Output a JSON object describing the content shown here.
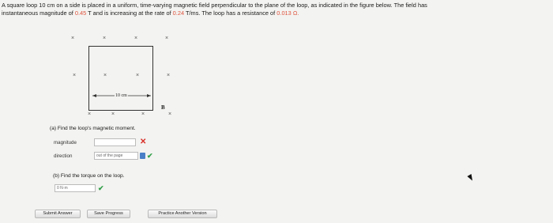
{
  "problem": {
    "pre1": "A square loop 10 cm on a side is placed in a uniform, time-varying magnetic field perpendicular to the plane of the loop, as indicated in the figure below. The field has",
    "pre2": "instantaneous magnitude of ",
    "value_b": "0.45",
    "mid1": " T and is increasing at the rate of ",
    "value_rate": "0.24",
    "mid2": " T/ms. The loop has a resistance of ",
    "value_r": "0.013",
    "unit_r": " Ω."
  },
  "figure": {
    "cross_glyph": "×",
    "dimension_label": "10 cm",
    "field_label": "B"
  },
  "part_a": {
    "title": "(a) Find the loop's magnetic moment.",
    "magnitude_label": "magnitude",
    "magnitude_value": "",
    "direction_label": "direction",
    "direction_value": "out of the page"
  },
  "part_b": {
    "title": "(b) Find the torque on the loop.",
    "torque_value": "0 N·m"
  },
  "marks": {
    "wrong": "✕",
    "correct": "✔"
  },
  "buttons": {
    "submit": "Submit Answer",
    "save": "Save Progress",
    "practice": "Practice Another Version"
  },
  "colors": {
    "highlight": "#e0533d",
    "wrong": "#d9302a",
    "correct": "#33a04a",
    "select_accent": "#4a7fc7"
  }
}
